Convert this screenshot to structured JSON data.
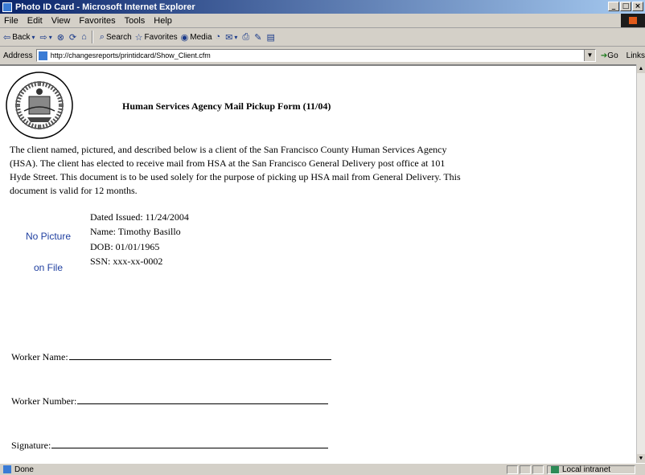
{
  "window": {
    "title": "Photo ID Card - Microsoft Internet Explorer",
    "controls": [
      "_",
      "□",
      "×"
    ]
  },
  "menu": [
    "File",
    "Edit",
    "View",
    "Favorites",
    "Tools",
    "Help"
  ],
  "toolbar": {
    "back": "Back",
    "search": "Search",
    "favorites": "Favorites",
    "media": "Media"
  },
  "address": {
    "label": "Address",
    "url": "http://changesreports/printidcard/Show_Client.cfm",
    "go": "Go",
    "links": "Links"
  },
  "page": {
    "title": "Human Services Agency Mail Pickup Form (11/04)",
    "intro": "The client named, pictured, and described below is a client of the San Francisco County Human Services Agency (HSA). The client has elected to receive mail from HSA at the San Francisco General Delivery post office at 101 Hyde Street. This document is to be used solely for the purpose of picking up HSA mail from General Delivery. This document is valid for 12 months.",
    "no_picture_1": "No Picture",
    "no_picture_2": "on File",
    "date_issued": "Dated Issued: 11/24/2004",
    "name": "Name: Timothy Basillo",
    "dob": "DOB: 01/01/1965",
    "ssn": "SSN: xxx-xx-0002",
    "worker_name_label": "Worker Name:",
    "worker_number_label": "Worker Number:",
    "signature_label": "Signature:"
  },
  "status": {
    "text": "Done",
    "zone": "Local intranet"
  }
}
